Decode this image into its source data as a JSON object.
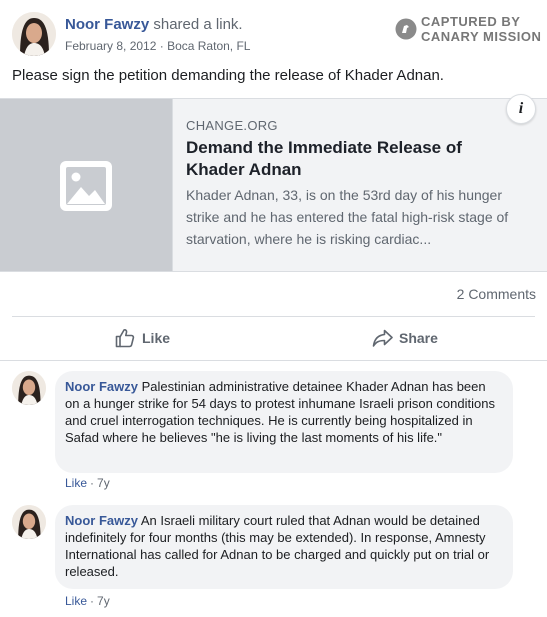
{
  "post": {
    "author": "Noor Fawzy",
    "action_text": "shared a link.",
    "date": "February 8, 2012",
    "separator": "·",
    "location": "Boca Raton, FL",
    "text": "Please sign the petition demanding the release of Khader Adnan."
  },
  "watermark": {
    "line1": "CAPTURED BY",
    "line2": "CANARY MISSION"
  },
  "link_preview": {
    "domain": "CHANGE.ORG",
    "title": "Demand the Immediate Release of Khader Adnan",
    "description": "Khader Adnan, 33, is on the 53rd day of his hunger strike and he has entered the fatal high-risk stage of starvation, where he is risking cardiac...",
    "info_label": "i"
  },
  "stats": {
    "comments": "2 Comments"
  },
  "actions": {
    "like_label": "Like",
    "share_label": "Share"
  },
  "comments": [
    {
      "author": "Noor Fawzy",
      "text": "Palestinian administrative detainee Khader Adnan has been on a hunger strike for 54 days to protest inhumane Israeli prison conditions and cruel interrogation techniques. He is currently being hospitalized in Safad where he believes \"he is living the last moments of his life.\"",
      "like_label": "Like",
      "separator": "·",
      "age": "7y"
    },
    {
      "author": "Noor Fawzy",
      "text": "An Israeli military court ruled that Adnan would be detained indefinitely for four months (this may be extended). In response, Amnesty International has called for Adnan to be charged and quickly put on trial or released.",
      "like_label": "Like",
      "separator": "·",
      "age": "7y"
    }
  ],
  "colors": {
    "link_blue": "#385898",
    "secondary_text": "#606770",
    "bubble_bg": "#f2f3f5",
    "card_bg": "#f2f3f5",
    "thumb_bg": "#c9ccd1"
  },
  "icons": {
    "avatar": "profile-photo",
    "watermark_logo": "canary-mission-logo",
    "thumbnail": "image-placeholder-icon",
    "like": "thumbs-up-icon",
    "share": "share-arrow-icon"
  }
}
